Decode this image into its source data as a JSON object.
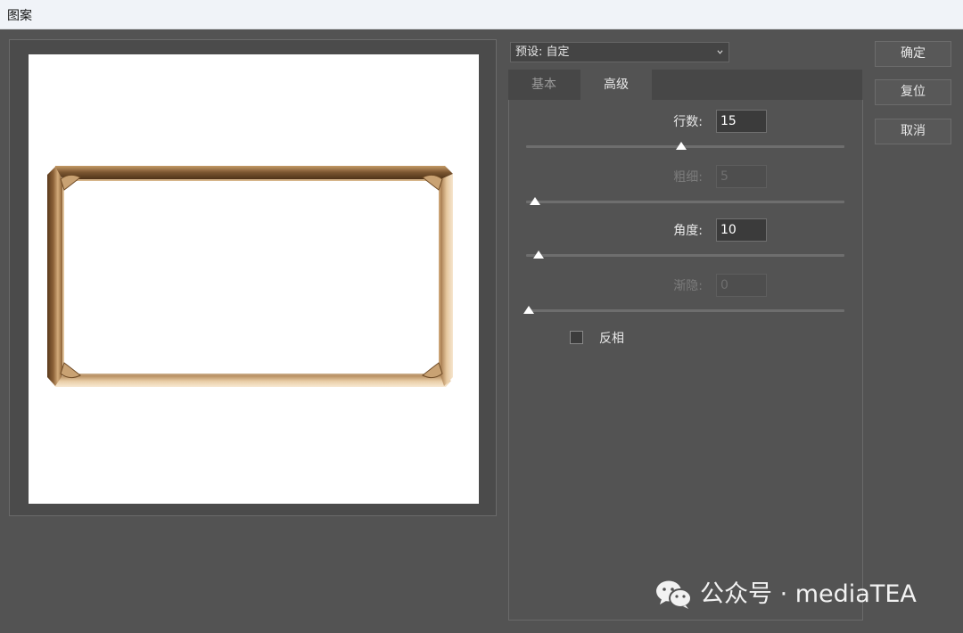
{
  "window": {
    "title": "图案"
  },
  "preset": {
    "label": "预设: 自定"
  },
  "tabs": [
    {
      "label": "基本",
      "active": false
    },
    {
      "label": "高级",
      "active": true
    }
  ],
  "fields": {
    "rows": {
      "label": "行数:",
      "value": "15",
      "enabled": true,
      "slider": 0.48
    },
    "thickness": {
      "label": "粗细:",
      "value": "5",
      "enabled": false,
      "slider": 0.02
    },
    "angle": {
      "label": "角度:",
      "value": "10",
      "enabled": true,
      "slider": 0.03
    },
    "fade": {
      "label": "渐隐:",
      "value": "0",
      "enabled": false,
      "slider": 0.0
    }
  },
  "invert": {
    "label": "反相",
    "checked": false
  },
  "buttons": {
    "ok": "确定",
    "reset": "复位",
    "cancel": "取消"
  },
  "watermark": {
    "text": "公众号 · mediaTEA",
    "icon": "wechat-icon"
  },
  "colors": {
    "background": "#535353",
    "frame_dark": "#7a5530",
    "frame_light": "#e8c9a0"
  }
}
